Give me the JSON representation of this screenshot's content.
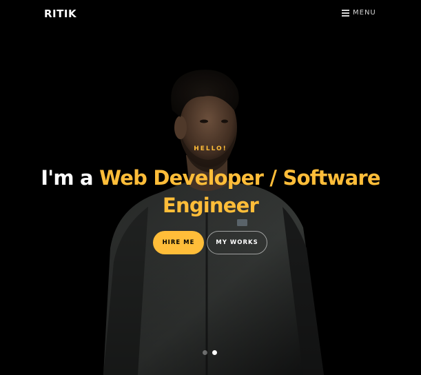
{
  "nav": {
    "logo": "RITIK",
    "menu_label": "MENU",
    "menu_icon": "hamburger-icon"
  },
  "hero": {
    "kicker": "HELLO!",
    "headline_prefix": "I'm a ",
    "headline_accent": "Web Developer / Software Engineer",
    "hire_label": "HIRE ME",
    "works_label": "MY WORKS",
    "slides_count": 2,
    "active_slide": 2
  },
  "colors": {
    "accent": "#ffbd39",
    "background": "#000000",
    "text": "#ffffff"
  }
}
